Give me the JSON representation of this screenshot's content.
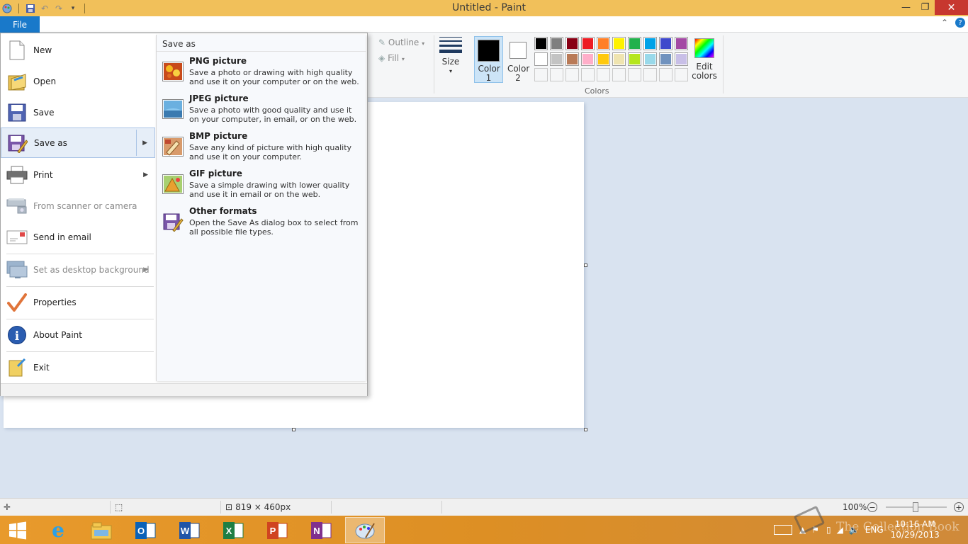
{
  "window": {
    "title": "Untitled - Paint"
  },
  "ribbon": {
    "file_tab": "File",
    "outline_label": "Outline",
    "fill_label": "Fill",
    "size_label": "Size",
    "color1_label": "Color 1",
    "color2_label": "Color 2",
    "colors_group_label": "Colors",
    "edit_colors_label": "Edit colors",
    "palette_row1": [
      "#000000",
      "#7f7f7f",
      "#880015",
      "#ed1c24",
      "#ff7f27",
      "#fff200",
      "#22b14c",
      "#00a2e8",
      "#3f48cc",
      "#a349a4"
    ],
    "palette_row2": [
      "#ffffff",
      "#c3c3c3",
      "#b97a57",
      "#ffaec9",
      "#ffc90e",
      "#efe4b0",
      "#b5e61d",
      "#99d9ea",
      "#7092be",
      "#c8bfe7"
    ]
  },
  "file_menu": {
    "items": [
      {
        "label": "New"
      },
      {
        "label": "Open"
      },
      {
        "label": "Save"
      },
      {
        "label": "Save as"
      },
      {
        "label": "Print"
      },
      {
        "label": "From scanner or camera"
      },
      {
        "label": "Send in email"
      },
      {
        "label": "Set as desktop background"
      },
      {
        "label": "Properties"
      },
      {
        "label": "About Paint"
      },
      {
        "label": "Exit"
      }
    ],
    "save_as_header": "Save as",
    "formats": [
      {
        "title": "PNG picture",
        "desc": "Save a photo or drawing with high quality and use it on your computer or on the web."
      },
      {
        "title": "JPEG picture",
        "desc": "Save a photo with good quality and use it on your computer, in email, or on the web."
      },
      {
        "title": "BMP picture",
        "desc": "Save any kind of picture with high quality and use it on your computer."
      },
      {
        "title": "GIF picture",
        "desc": "Save a simple drawing with lower quality and use it in email or on the web."
      },
      {
        "title": "Other formats",
        "desc": "Open the Save As dialog box to select from all possible file types."
      }
    ]
  },
  "statusbar": {
    "dimensions": "819 × 460px",
    "zoom": "100%"
  },
  "taskbar": {
    "time": "10:16 AM",
    "date": "10/29/2013",
    "language": "ENG"
  },
  "watermark": "The Collection Book"
}
